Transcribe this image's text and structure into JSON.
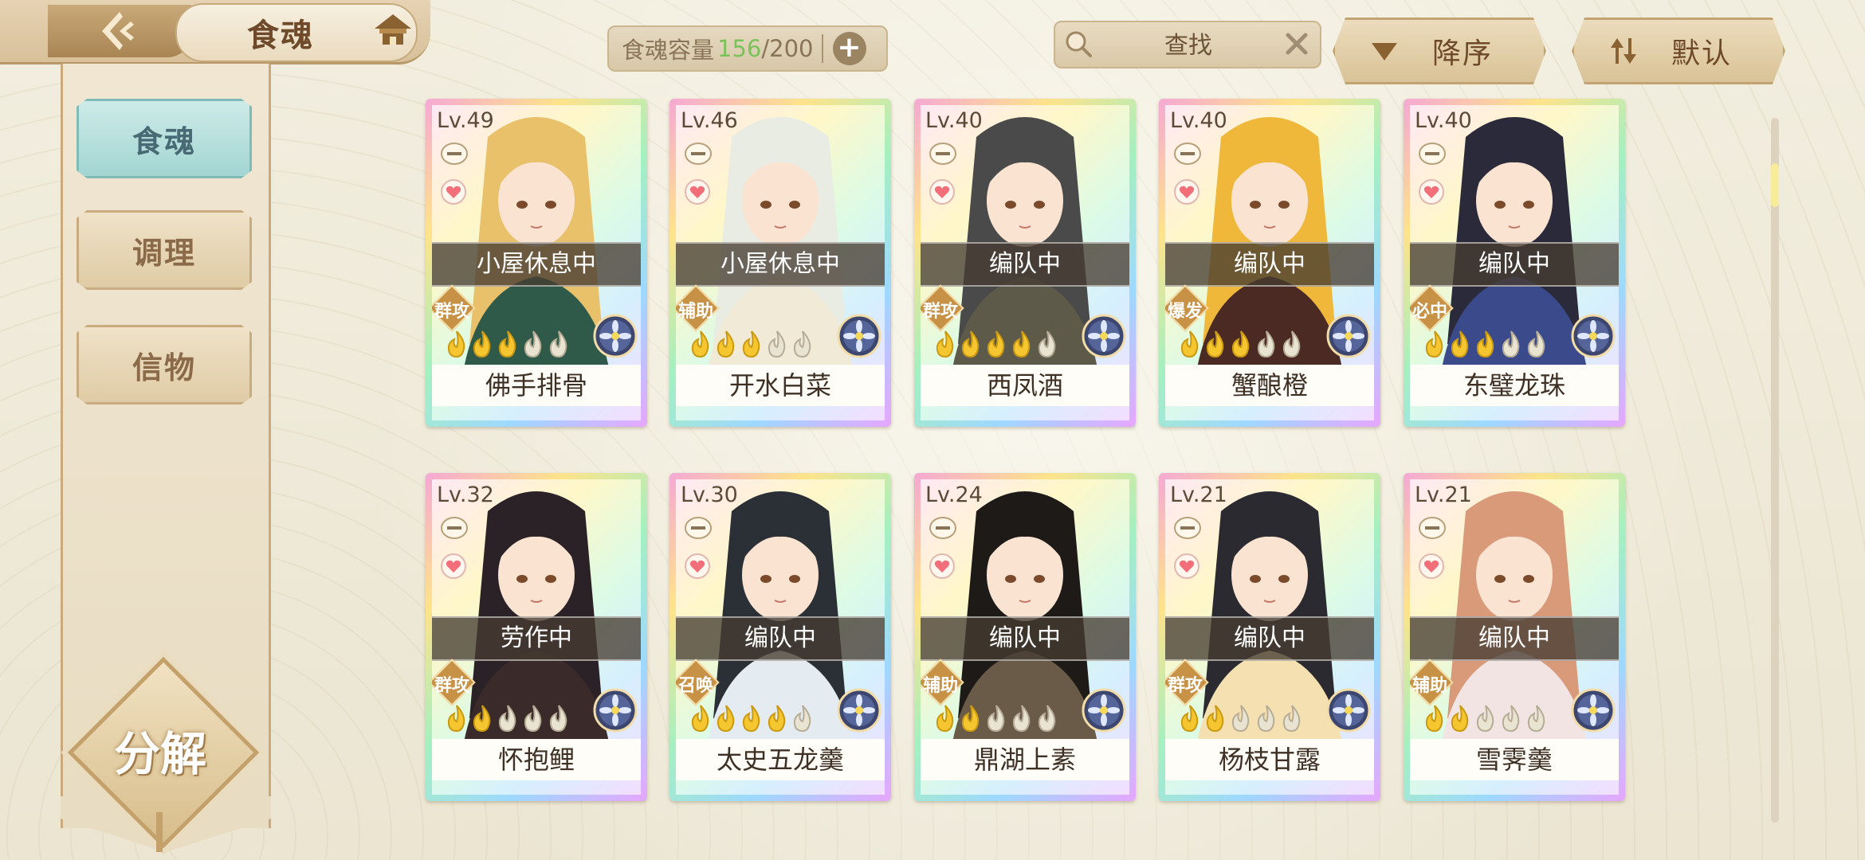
{
  "header": {
    "title": "食魂",
    "capacity_label": "食魂容量",
    "capacity_current": "156",
    "capacity_max": "/200",
    "capacity_add": "+"
  },
  "search": {
    "placeholder": "查找"
  },
  "sort": {
    "order_label": "降序",
    "default_label": "默认"
  },
  "sidebar": {
    "items": [
      {
        "label": "食魂",
        "active": true
      },
      {
        "label": "调理",
        "active": false
      },
      {
        "label": "信物",
        "active": false
      }
    ],
    "decompose_label": "分解"
  },
  "colors": {
    "capacity_current": "#7ac35a",
    "status_overlay": "#463c32",
    "active_tab": "#a3d5d2",
    "accent_brown": "#6e4a2a"
  },
  "cards": [
    {
      "level": "Lv.49",
      "status": "小屋休息中",
      "role": "群攻",
      "name": "佛手排骨",
      "stars_filled": 3,
      "stars_total": 5,
      "hair": "#e9c16a",
      "robe": "#2f5a4a"
    },
    {
      "level": "Lv.46",
      "status": "小屋休息中",
      "role": "辅助",
      "name": "开水白菜",
      "stars_filled": 3,
      "stars_total": 5,
      "hair": "#e8ece2",
      "robe": "#f0ead6"
    },
    {
      "level": "Lv.40",
      "status": "编队中",
      "role": "群攻",
      "name": "西凤酒",
      "stars_filled": 4,
      "stars_total": 5,
      "hair": "#4a4a4a",
      "robe": "#5d5a4a"
    },
    {
      "level": "Lv.40",
      "status": "编队中",
      "role": "爆发",
      "name": "蟹酿橙",
      "stars_filled": 3,
      "stars_total": 5,
      "hair": "#f0b83a",
      "robe": "#4a2a22"
    },
    {
      "level": "Lv.40",
      "status": "编队中",
      "role": "必中",
      "name": "东璧龙珠",
      "stars_filled": 3,
      "stars_total": 5,
      "hair": "#2a2a3a",
      "robe": "#3a4a8a"
    },
    {
      "level": "Lv.32",
      "status": "劳作中",
      "role": "群攻",
      "name": "怀抱鲤",
      "stars_filled": 2,
      "stars_total": 5,
      "hair": "#2a2226",
      "robe": "#3a2a2a"
    },
    {
      "level": "Lv.30",
      "status": "编队中",
      "role": "召唤",
      "name": "太史五龙羹",
      "stars_filled": 4,
      "stars_total": 5,
      "hair": "#2a3036",
      "robe": "#e4ecf2"
    },
    {
      "level": "Lv.24",
      "status": "编队中",
      "role": "辅助",
      "name": "鼎湖上素",
      "stars_filled": 2,
      "stars_total": 5,
      "hair": "#1e1a18",
      "robe": "#6a5a48"
    },
    {
      "level": "Lv.21",
      "status": "编队中",
      "role": "群攻",
      "name": "杨枝甘露",
      "stars_filled": 2,
      "stars_total": 5,
      "hair": "#2a2a30",
      "robe": "#f4e0b0"
    },
    {
      "level": "Lv.21",
      "status": "编队中",
      "role": "辅助",
      "name": "雪霁羹",
      "stars_filled": 2,
      "stars_total": 5,
      "hair": "#d99a7a",
      "robe": "#f3e4e4"
    }
  ]
}
